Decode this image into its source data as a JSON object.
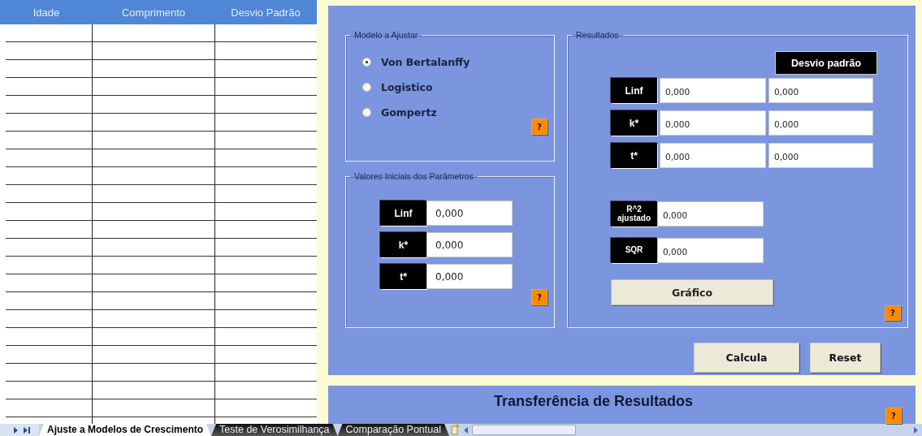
{
  "table": {
    "columns": [
      "Idade",
      "Comprimento",
      "Desvio Padrão"
    ]
  },
  "model": {
    "legend": "Modelo a Ajustar",
    "help": "?",
    "options": [
      {
        "label": "Von Bertalanffy",
        "selected": true
      },
      {
        "label": "Logistico",
        "selected": false
      },
      {
        "label": "Gompertz",
        "selected": false
      }
    ]
  },
  "initial": {
    "legend": "Valores Iniciais dos Parâmetros",
    "help": "?",
    "params": [
      {
        "label": "Linf",
        "value": "0,000"
      },
      {
        "label": "k*",
        "value": "0,000"
      },
      {
        "label": "t*",
        "value": "0,000"
      }
    ]
  },
  "results": {
    "legend": "Resultados",
    "column_header": "Desvio padrão",
    "help": "?",
    "graph_button": "Gráfico",
    "params": [
      {
        "label": "Linf",
        "value": "0,000",
        "deviation": "0,000"
      },
      {
        "label": "k*",
        "value": "0,000",
        "deviation": "0,000"
      },
      {
        "label": "t*",
        "value": "0,000",
        "deviation": "0,000"
      }
    ],
    "stats": [
      {
        "label": "R^2 ajustado",
        "value": "0,000"
      },
      {
        "label": "SQR",
        "value": "0,000"
      }
    ]
  },
  "buttons": [
    "Calcula",
    "Reset"
  ],
  "transfer": {
    "title": "Transferência de Resultados",
    "help": "?"
  },
  "sheet_tabs": [
    {
      "label": "Ajuste a Modelos de Crescimento",
      "selected": true
    },
    {
      "label": "Teste de Verosimilhança",
      "selected": false
    },
    {
      "label": "Comparação Pontual",
      "selected": false
    }
  ]
}
